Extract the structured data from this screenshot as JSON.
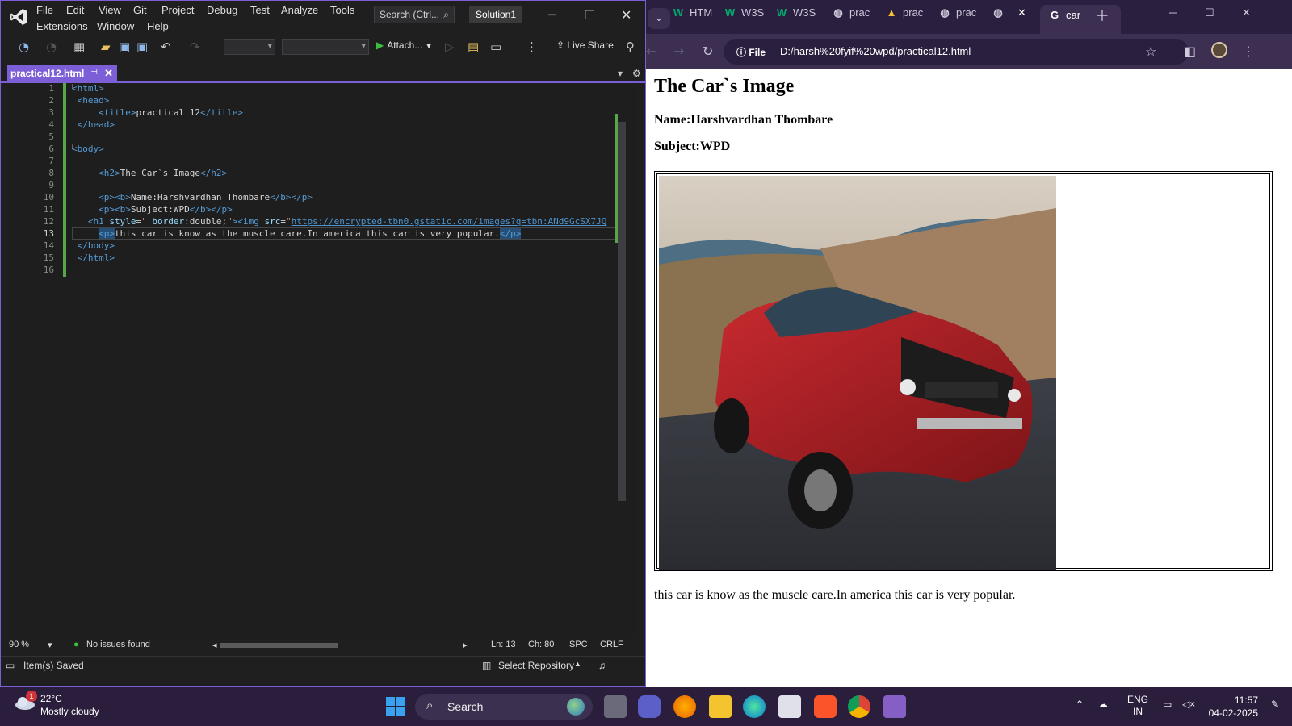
{
  "vs": {
    "menu": [
      "File",
      "Edit",
      "View",
      "Git",
      "Project",
      "Debug",
      "Test",
      "Analyze",
      "Tools",
      "Extensions",
      "Window",
      "Help"
    ],
    "search_label": "Search (Ctrl...",
    "solution_name": "Solution1",
    "toolbar": {
      "attach_label": "Attach...",
      "live_share_label": "Live Share"
    },
    "tab": {
      "filename": "practical12.html"
    },
    "code": {
      "line_numbers": [
        "1",
        "2",
        "3",
        "4",
        "5",
        "6",
        "7",
        "8",
        "9",
        "10",
        "11",
        "12",
        "13",
        "14",
        "15",
        "16"
      ],
      "current_line": "13"
    },
    "status": {
      "zoom": "90 %",
      "issues": "No issues found",
      "ln": "Ln: 13",
      "ch": "Ch: 80",
      "spc": "SPC",
      "crlf": "CRLF",
      "saved": "Item(s) Saved",
      "repo": "Select Repository"
    }
  },
  "chrome": {
    "tabs": [
      {
        "icon": "w3schools-icon",
        "label": "HTM"
      },
      {
        "icon": "w3schools-icon",
        "label": "W3S"
      },
      {
        "icon": "w3schools-icon",
        "label": "W3S"
      },
      {
        "icon": "globe-icon",
        "label": "prac"
      },
      {
        "icon": "drive-icon",
        "label": "prac"
      },
      {
        "icon": "globe-icon",
        "label": "prac"
      },
      {
        "icon": "globe-icon",
        "label": ""
      },
      {
        "icon": "google-icon",
        "label": "car"
      }
    ],
    "address_scheme": "File",
    "address_url": "D:/harsh%20fyif%20wpd/practical12.html"
  },
  "page": {
    "heading": "The Car`s Image",
    "name": "Name:Harshvardhan Thombare",
    "subject": "Subject:WPD",
    "caption": "this car is know as the muscle care.In america this car is very popular."
  },
  "taskbar": {
    "temperature": "22°C",
    "weather": "Mostly cloudy",
    "notification_count": "1",
    "search_label": "Search",
    "lang_primary": "ENG",
    "lang_secondary": "IN",
    "time": "11:57",
    "date": "04-02-2025"
  },
  "colors": {
    "vs_accent": "#7c5fd6",
    "chrome_frame": "#2b1f3f",
    "change_bar": "#57a64a"
  }
}
